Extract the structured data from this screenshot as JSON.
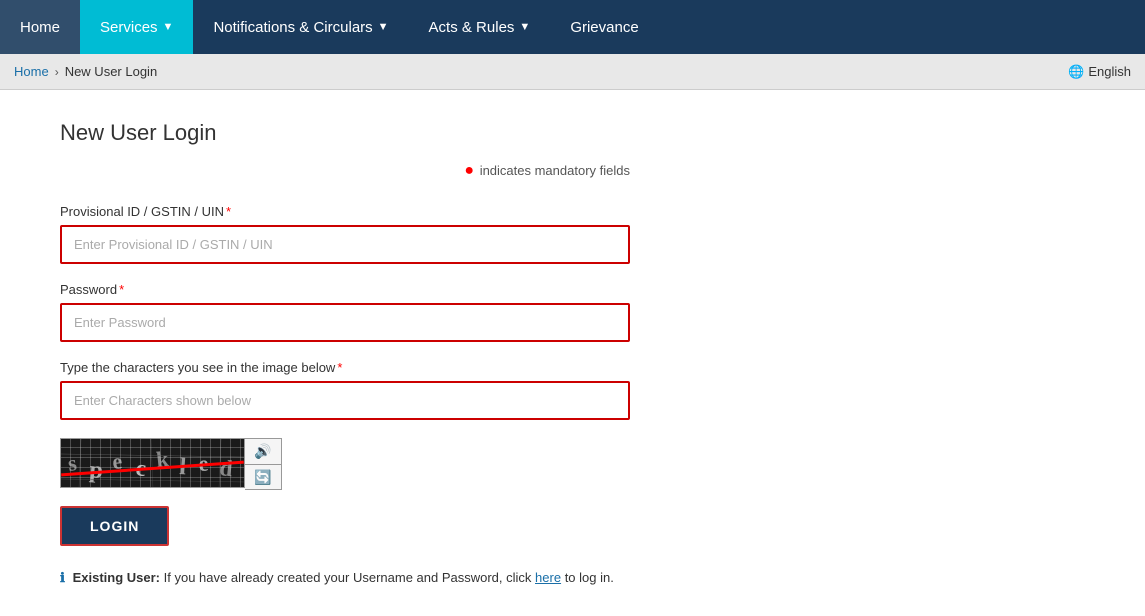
{
  "nav": {
    "items": [
      {
        "id": "home",
        "label": "Home",
        "active": false,
        "hasDropdown": false
      },
      {
        "id": "services",
        "label": "Services",
        "active": true,
        "hasDropdown": true
      },
      {
        "id": "notifications",
        "label": "Notifications & Circulars",
        "active": false,
        "hasDropdown": true
      },
      {
        "id": "acts",
        "label": "Acts & Rules",
        "active": false,
        "hasDropdown": true
      },
      {
        "id": "grievance",
        "label": "Grievance",
        "active": false,
        "hasDropdown": false
      }
    ]
  },
  "breadcrumb": {
    "home_label": "Home",
    "separator": "›",
    "current": "New User Login"
  },
  "lang": {
    "icon": "🌐",
    "label": "English"
  },
  "page": {
    "title": "New User Login",
    "mandatory_note": "indicates mandatory fields"
  },
  "form": {
    "provisional_id": {
      "label": "Provisional ID / GSTIN / UIN",
      "placeholder": "Enter Provisional ID / GSTIN / UIN"
    },
    "password": {
      "label": "Password",
      "placeholder": "Enter Password"
    },
    "captcha": {
      "label": "Type the characters you see in the image below",
      "placeholder": "Enter Characters shown below"
    },
    "login_button": "LOGIN"
  },
  "existing_user": {
    "prefix": "Existing User:",
    "message": " If you have already created your Username and Password, click ",
    "link_text": "here",
    "suffix": " to log in."
  }
}
